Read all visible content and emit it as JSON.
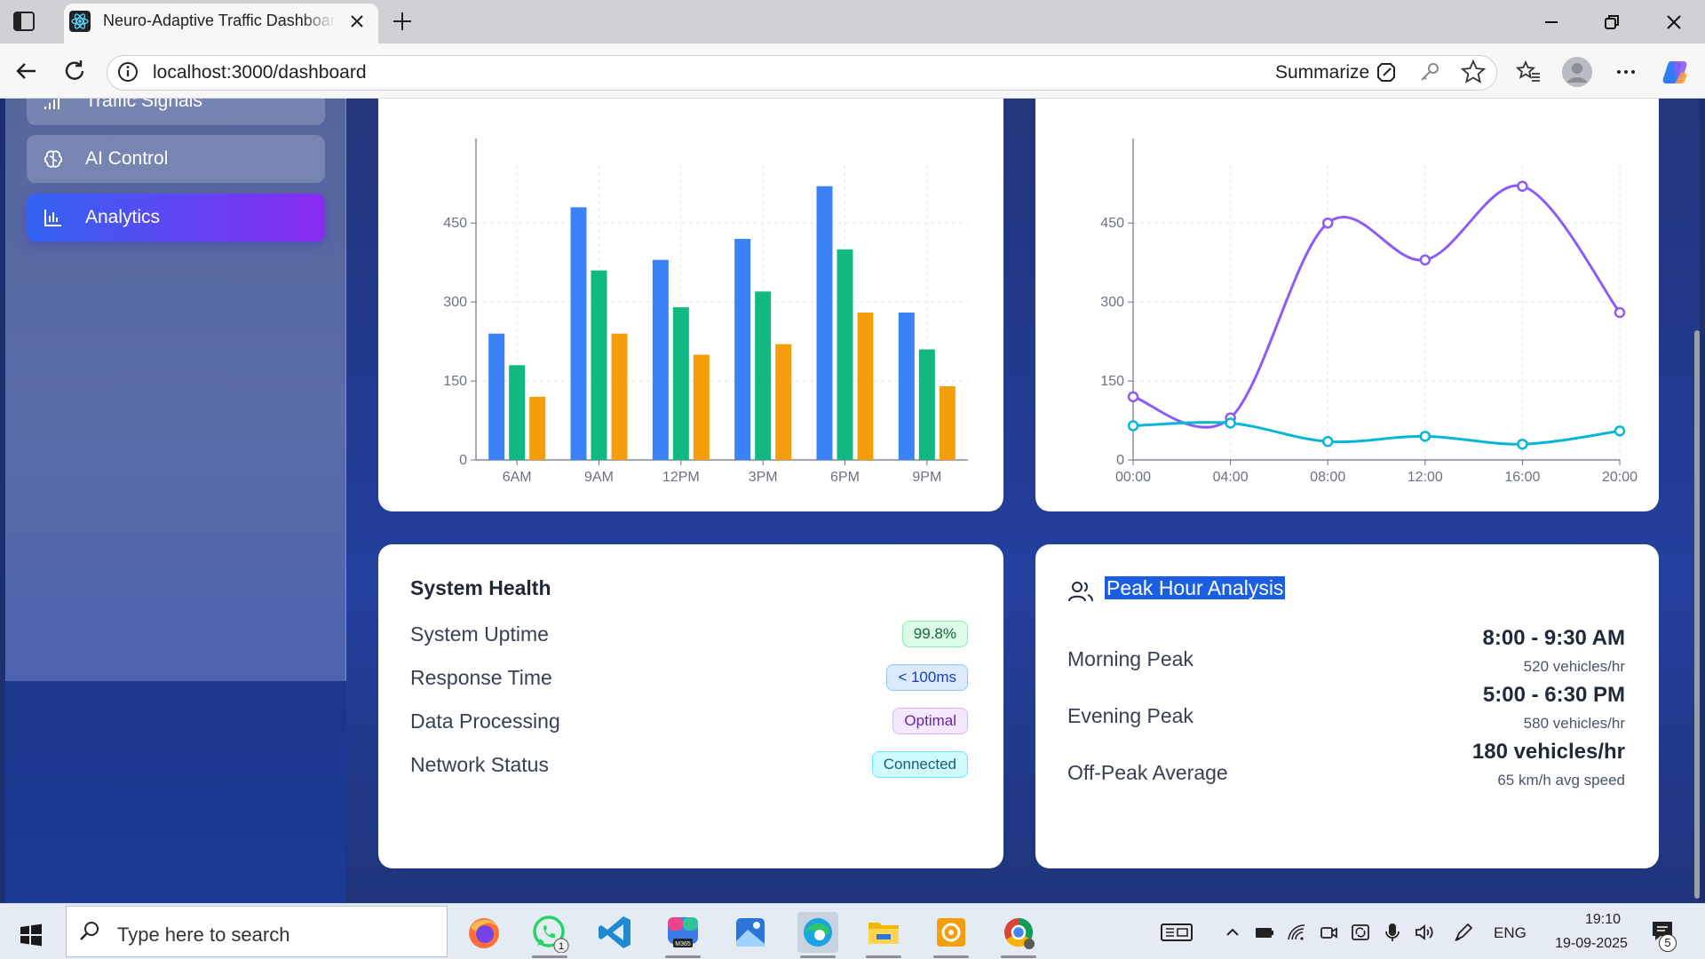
{
  "browser": {
    "tab_title": "Neuro-Adaptive Traffic Dashboard",
    "url": "localhost:3000/dashboard",
    "summarize_label": "Summarize"
  },
  "sidebar": {
    "items": [
      {
        "label": "Traffic Signals",
        "icon": "signal-bars-icon",
        "active": false
      },
      {
        "label": "AI Control",
        "icon": "brain-icon",
        "active": false
      },
      {
        "label": "Analytics",
        "icon": "bar-chart-icon",
        "active": true
      }
    ]
  },
  "colors": {
    "series_blue": "#3b82f6",
    "series_green": "#10b981",
    "series_orange": "#f59e0b",
    "line_purple": "#8b5cf6",
    "line_cyan": "#06b6d4",
    "accent_gradient_start": "#3163f2",
    "accent_gradient_end": "#8a2bf2"
  },
  "chart_data": [
    {
      "type": "bar",
      "categories": [
        "6AM",
        "9AM",
        "12PM",
        "3PM",
        "6PM",
        "9PM"
      ],
      "series": [
        {
          "values": [
            240,
            480,
            380,
            420,
            520,
            280
          ],
          "color": "#3b82f6"
        },
        {
          "values": [
            180,
            360,
            290,
            320,
            400,
            210
          ],
          "color": "#10b981"
        },
        {
          "values": [
            120,
            240,
            200,
            220,
            280,
            140
          ],
          "color": "#f59e0b"
        }
      ],
      "yticks": [
        0,
        150,
        300,
        450
      ],
      "ylim": [
        0,
        560
      ],
      "grid": true
    },
    {
      "type": "line",
      "x": [
        "00:00",
        "04:00",
        "08:00",
        "12:00",
        "16:00",
        "20:00"
      ],
      "series": [
        {
          "values": [
            120,
            80,
            450,
            380,
            520,
            280
          ],
          "color": "#8b5cf6"
        },
        {
          "values": [
            65,
            70,
            35,
            45,
            30,
            55
          ],
          "color": "#06b6d4"
        }
      ],
      "yticks": [
        0,
        150,
        300,
        450
      ],
      "ylim": [
        0,
        560
      ],
      "grid": true
    }
  ],
  "system_health": {
    "title": "System Health",
    "rows": [
      {
        "label": "System Uptime",
        "value": "99.8%",
        "bg": "#dcfce7",
        "border": "#86efac",
        "fg": "#166534"
      },
      {
        "label": "Response Time",
        "value": "< 100ms",
        "bg": "#dbeafe",
        "border": "#93c5fd",
        "fg": "#1e40af"
      },
      {
        "label": "Data Processing",
        "value": "Optimal",
        "bg": "#f3e8ff",
        "border": "#d8b4fe",
        "fg": "#6b21a8"
      },
      {
        "label": "Network Status",
        "value": "Connected",
        "bg": "#cffafe",
        "border": "#67e8f9",
        "fg": "#155e75"
      }
    ]
  },
  "peak_analysis": {
    "title": "Peak Hour Analysis",
    "rows": [
      {
        "label": "Morning Peak",
        "value": "8:00 - 9:30 AM",
        "sub": "520 vehicles/hr"
      },
      {
        "label": "Evening Peak",
        "value": "5:00 - 6:30 PM",
        "sub": "580 vehicles/hr"
      },
      {
        "label": "Off-Peak Average",
        "value": "180 vehicles/hr",
        "sub": "65 km/h avg speed"
      }
    ]
  },
  "taskbar": {
    "search_placeholder": "Type here to search",
    "whatsapp_badge": "1",
    "language": "ENG",
    "time": "19:10",
    "date": "19-09-2025",
    "notifications": "5"
  }
}
